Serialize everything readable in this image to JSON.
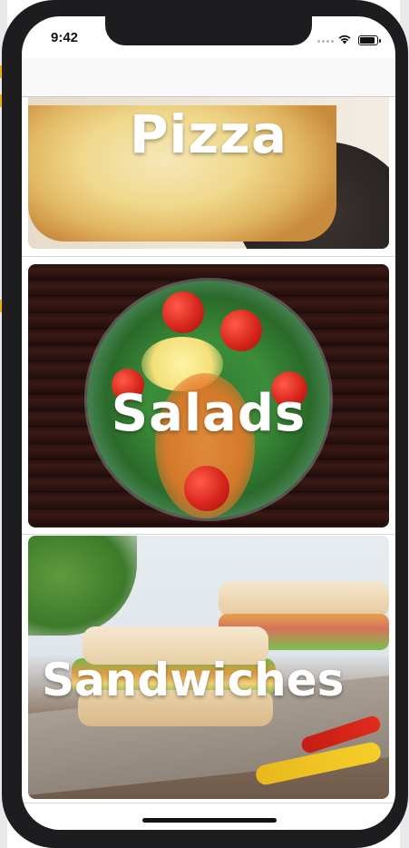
{
  "status_bar": {
    "time": "9:42"
  },
  "categories": [
    {
      "name": "Pizza"
    },
    {
      "name": "Salads"
    },
    {
      "name": "Sandwiches"
    }
  ]
}
